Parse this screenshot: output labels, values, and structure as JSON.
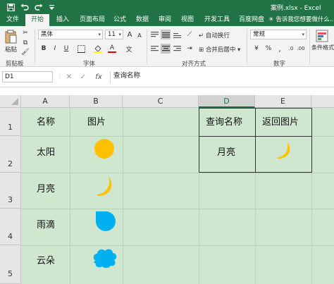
{
  "title_bar": {
    "document_title": "案例.xlsx - Excel",
    "quick_access": [
      "save-icon",
      "undo-icon",
      "redo-icon",
      "customize-icon"
    ],
    "bg_color": "#217346"
  },
  "tabs": [
    "文件",
    "开始",
    "插入",
    "页面布局",
    "公式",
    "数据",
    "审阅",
    "视图",
    "开发工具",
    "百度网盘"
  ],
  "active_tab": "开始",
  "tell_me": "告诉我您想要做什么...",
  "ribbon": {
    "clipboard": {
      "paste": "粘贴",
      "label": "剪贴板"
    },
    "font": {
      "name": "黑体",
      "size": "11",
      "grow": "A",
      "shrink": "A",
      "bold": "B",
      "italic": "I",
      "underline": "U",
      "font_color_letter": "A",
      "phonetic": "文",
      "label": "字体"
    },
    "alignment": {
      "wrap_text": "自动换行",
      "merge_center": "合并后居中",
      "label": "对齐方式"
    },
    "number": {
      "format": "常规",
      "label": "数字"
    },
    "styles": {
      "conditional_formatting": "条件格式"
    }
  },
  "formula_bar": {
    "name_box": "D1",
    "cancel": "✕",
    "enter": "✓",
    "fx": "fx",
    "formula": "查询名称"
  },
  "sheet": {
    "columns": [
      "A",
      "B",
      "C",
      "D",
      "E"
    ],
    "selected_column": "D",
    "rows": [
      "1",
      "2",
      "3",
      "4",
      "5"
    ],
    "headers": {
      "A1": "名称",
      "B1": "图片",
      "D1": "查询名称",
      "E1": "返回图片"
    },
    "names": [
      "太阳",
      "月亮",
      "雨滴",
      "云朵"
    ],
    "pictures": [
      "sun-icon",
      "moon-icon",
      "raindrop-icon",
      "cloud-icon"
    ],
    "query_value": "月亮",
    "result_picture": "moon-icon",
    "fill_color": "#cfe7cf",
    "sun_color": "#ffc000",
    "blue_color": "#00b0f0"
  }
}
